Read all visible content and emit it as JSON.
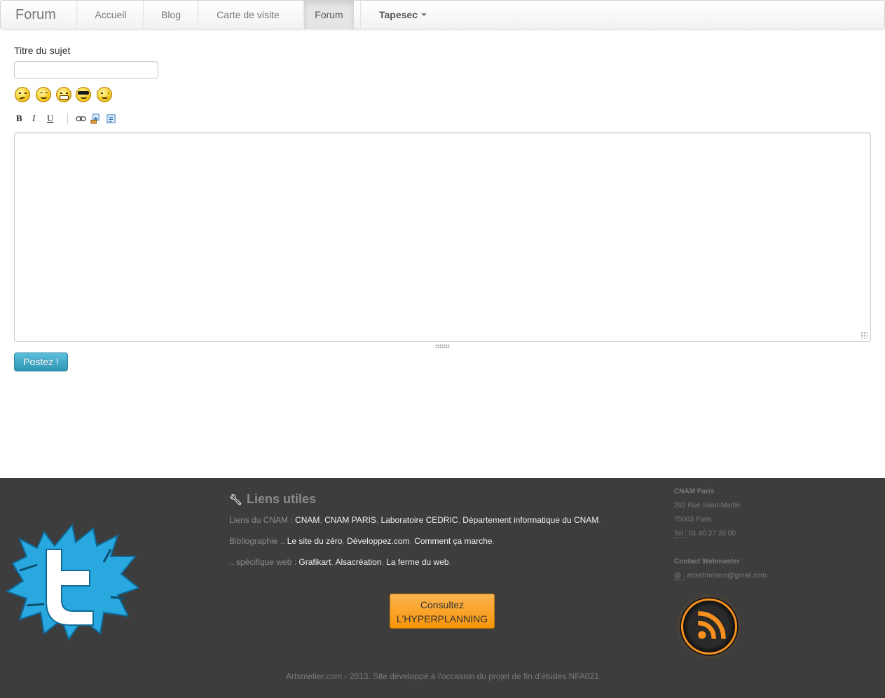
{
  "navbar": {
    "brand": "Forum",
    "items": [
      {
        "label": "Accueil"
      },
      {
        "label": "Blog"
      },
      {
        "label": "Carte de visite"
      },
      {
        "label": "Forum",
        "active": true
      },
      {
        "label": "Tapesec"
      }
    ]
  },
  "form": {
    "title_label": "Titre du sujet",
    "title_value": "",
    "smileys": [
      "thinking-smiley-icon",
      "squint-smiley-icon",
      "grin-smiley-icon",
      "cool-smiley-icon",
      "wink-smiley-icon"
    ],
    "toolbar": {
      "bold": "B",
      "italic": "I",
      "underline": "U"
    },
    "editor_value": "",
    "submit_label": "Postez !"
  },
  "footer": {
    "useful_title": "Liens utiles",
    "cnam_prefix": "Liens du CNAM :",
    "cnam_links": [
      "CNAM",
      "CNAM PARIS",
      "Laboratoire CEDRIC",
      "Département informatique du CNAM"
    ],
    "biblio_prefix": "Bibliographie ..",
    "biblio_links": [
      "Le site du zéro",
      "Développez.com",
      "Comment ça marche"
    ],
    "web_prefix": ".. spécifique web :",
    "web_links": [
      "Grafikart",
      "Alsacréation",
      "La ferme du web"
    ],
    "hyperplanning_line1": "Consultez",
    "hyperplanning_line2": "L'HYPERPLANNING",
    "address_name": "CNAM Paris",
    "address_street": "292 Rue Saint-Martin",
    "address_city": "75003 Paris",
    "tel_label": "Tel :",
    "tel_value": "01 40 27 20 00",
    "contact_title": "Contact Webmaster",
    "email_label": "@ :",
    "email_value": "artsetmetiers@gmail.com",
    "copyright": "Artsmetier.com - 2013. Site développé à l'occasion du projet de fin d'études NFA021"
  },
  "colors": {
    "footer_bg": "#3d3d3d",
    "post_button": "#49afcd",
    "hyperplanning_button": "#f89406",
    "rss_ring": "#f7901e"
  }
}
